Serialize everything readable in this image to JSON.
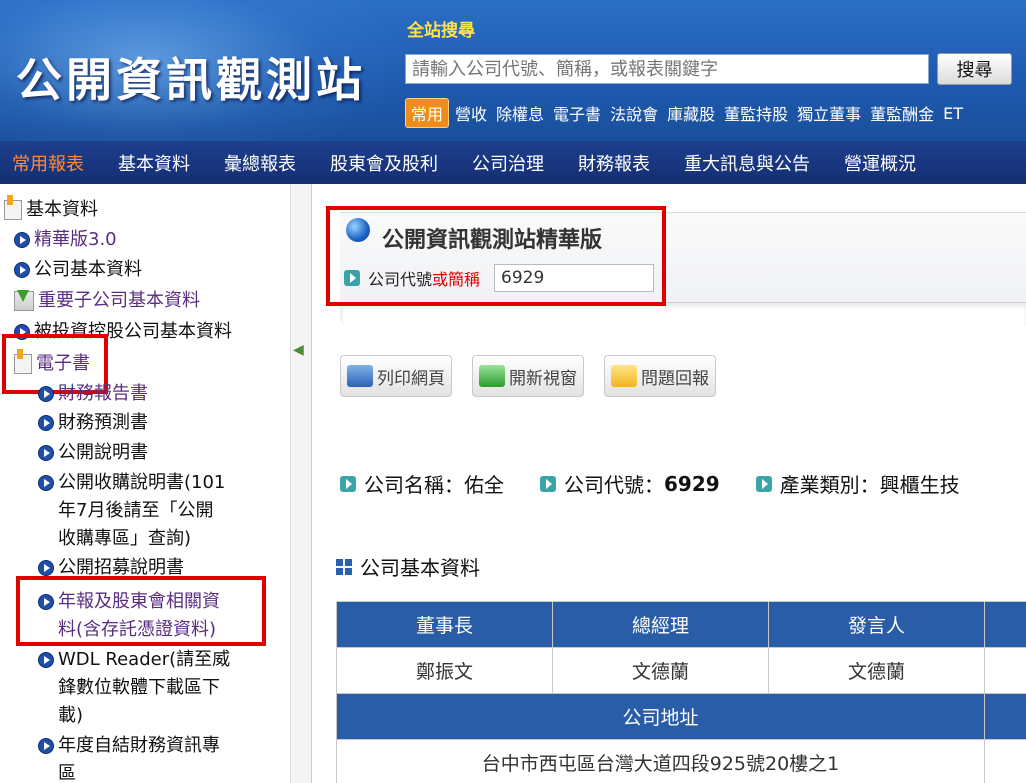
{
  "header": {
    "logo": "公開資訊觀測站",
    "search_title": "全站搜尋",
    "search_placeholder": "請輸入公司代號、簡稱，或報表關鍵字",
    "search_button": "搜尋",
    "quick_badge": "常用",
    "quick_links": [
      "營收",
      "除權息",
      "電子書",
      "法說會",
      "庫藏股",
      "董監持股",
      "獨立董事",
      "董監酬金",
      "ET"
    ]
  },
  "nav": [
    "常用報表",
    "基本資料",
    "彙總報表",
    "股東會及股利",
    "公司治理",
    "財務報表",
    "重大訊息與公告",
    "營運概況"
  ],
  "sidebar": {
    "items": [
      "基本資料",
      "精華版3.0",
      "公司基本資料",
      "重要子公司基本資料",
      "被投資控股公司基本資料",
      "電子書",
      "財務報告書",
      "財務預測書",
      "公開說明書",
      "公開收購說明書(101",
      "年7月後請至「公開",
      "收購專區」查詢)",
      "公開招募說明書",
      "年報及股東會相關資",
      "料(含存託憑證資料)",
      "WDL Reader(請至威",
      "鋒數位軟體下載區下",
      "載)",
      "年度自結財務資訊專",
      "區"
    ]
  },
  "panel": {
    "title": "公開資訊觀測站精華版",
    "code_label": "公司代號",
    "code_label_red": "或簡稱",
    "code_value": "6929"
  },
  "toolbar": {
    "print": "列印網頁",
    "new_window": "開新視窗",
    "feedback": "問題回報"
  },
  "company": {
    "name_label": "公司名稱：",
    "name": "佑全",
    "code_label": "公司代號：",
    "code": "6929",
    "industry_label": "產業類別：",
    "industry": "興櫃生技"
  },
  "section": {
    "title": "公司基本資料",
    "headers": [
      "董事長",
      "總經理",
      "發言人"
    ],
    "values": [
      "鄭振文",
      "文德蘭",
      "文德蘭"
    ],
    "address_label": "公司地址",
    "address": "台中市西屯區台灣大道四段925號20樓之1"
  }
}
